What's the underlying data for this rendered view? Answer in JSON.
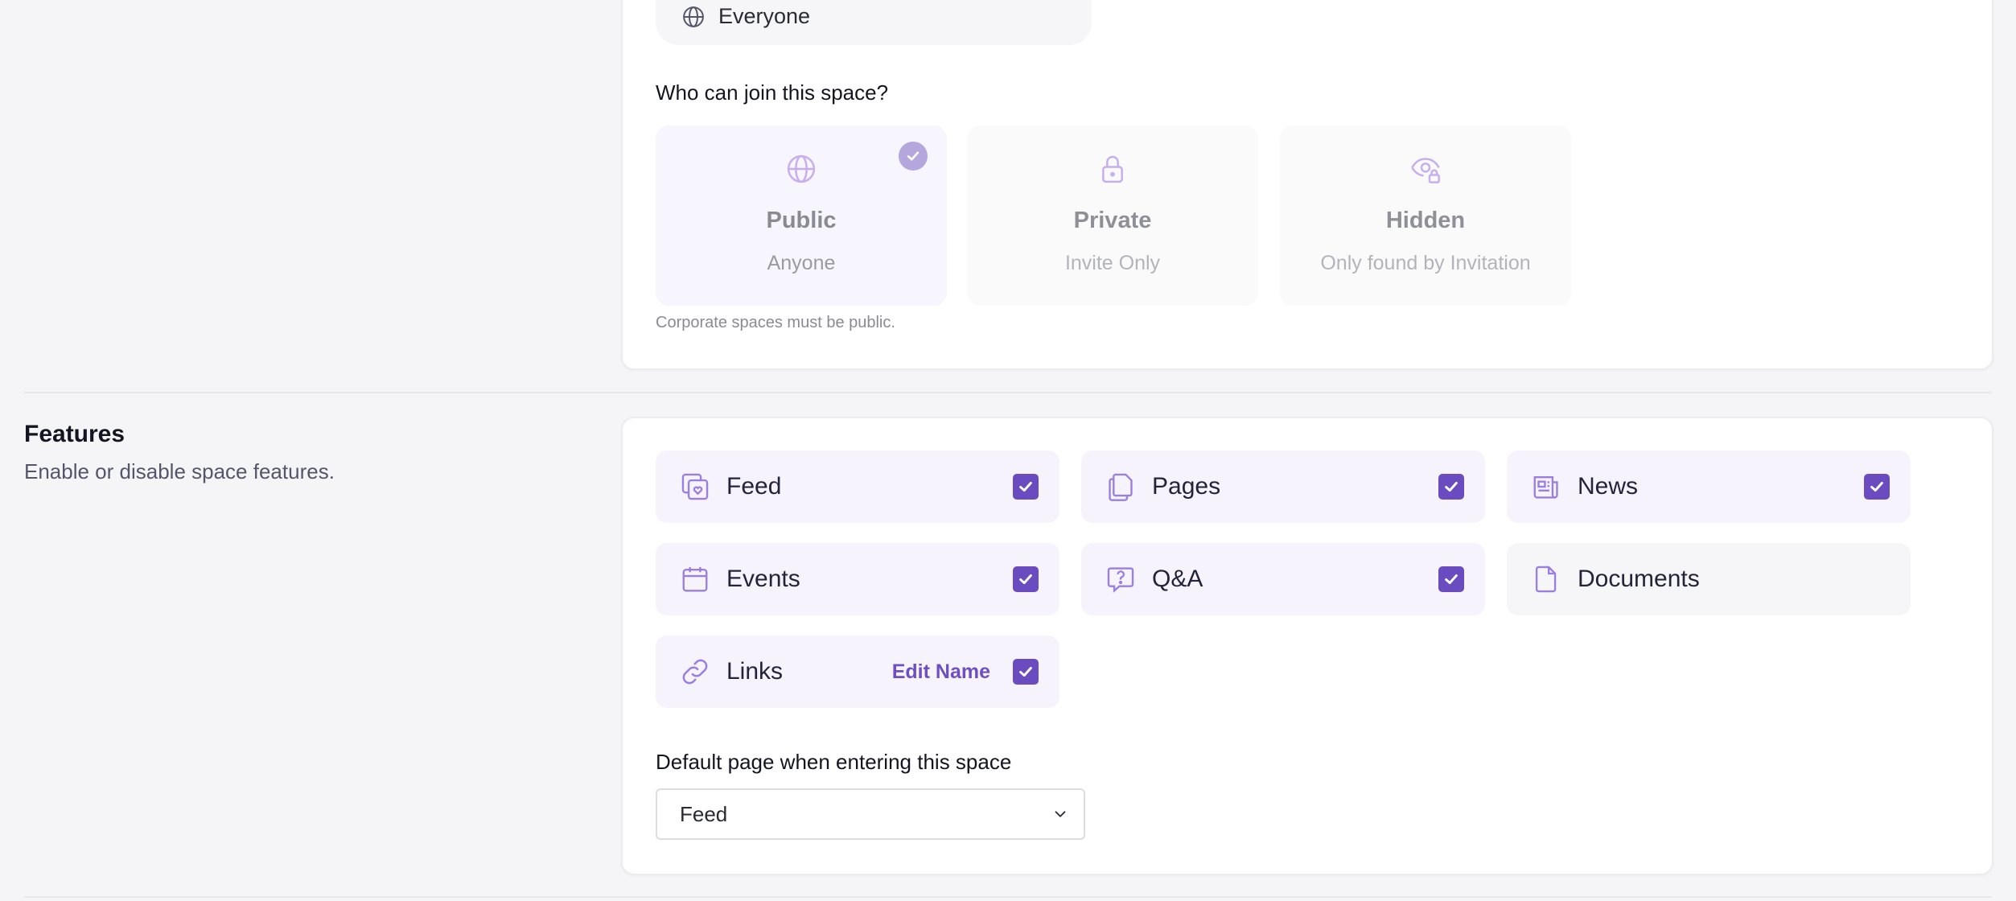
{
  "access": {
    "visibility_value": "Everyone",
    "visibility_icon": "globe-icon",
    "join_label": "Who can join this space?",
    "options": [
      {
        "title": "Public",
        "subtitle": "Anyone",
        "icon": "globe-icon",
        "selected": true
      },
      {
        "title": "Private",
        "subtitle": "Invite Only",
        "icon": "lock-icon",
        "selected": false
      },
      {
        "title": "Hidden",
        "subtitle": "Only found by Invitation",
        "icon": "eye-lock-icon",
        "selected": false
      }
    ],
    "hint": "Corporate spaces must be public."
  },
  "features": {
    "title": "Features",
    "description": "Enable or disable space features.",
    "items": [
      {
        "label": "Feed",
        "icon": "feed-icon",
        "enabled": true
      },
      {
        "label": "Pages",
        "icon": "pages-icon",
        "enabled": true
      },
      {
        "label": "News",
        "icon": "news-icon",
        "enabled": true
      },
      {
        "label": "Events",
        "icon": "calendar-icon",
        "enabled": true
      },
      {
        "label": "Q&A",
        "icon": "question-bubble-icon",
        "enabled": true
      },
      {
        "label": "Documents",
        "icon": "document-icon",
        "enabled": false
      },
      {
        "label": "Links",
        "icon": "link-icon",
        "enabled": true,
        "action": "Edit Name"
      }
    ],
    "default_page_label": "Default page when entering this space",
    "default_page_value": "Feed"
  },
  "colors": {
    "accent": "#6b4bc0",
    "accent_light": "#f6f3fd",
    "icon_purple": "#9b7fe0",
    "page_bg": "#f5f5f7"
  }
}
